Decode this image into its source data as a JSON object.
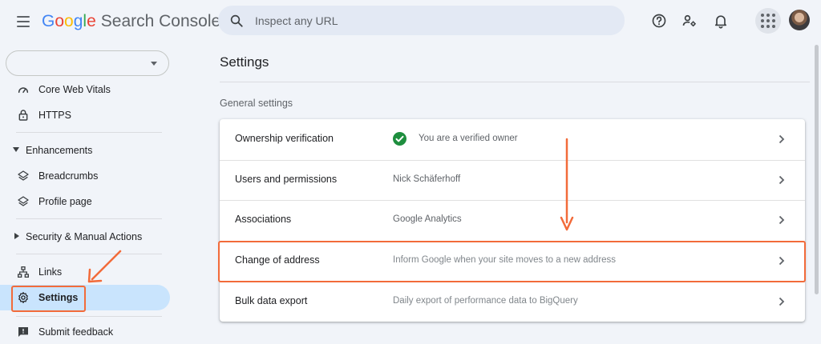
{
  "app": {
    "brand_letters": [
      "G",
      "o",
      "o",
      "g",
      "l",
      "e"
    ],
    "product": "Search Console"
  },
  "search": {
    "placeholder": "Inspect any URL"
  },
  "toolbar": {
    "icons": [
      "help-icon",
      "manage-accounts-icon",
      "notifications-icon",
      "apps-icon",
      "avatar"
    ]
  },
  "sidebar": {
    "property_value": "",
    "items": [
      {
        "label": "Core Web Vitals",
        "icon": "speed-gauge-icon"
      },
      {
        "label": "HTTPS",
        "icon": "lock-icon"
      },
      {
        "label": "Enhancements",
        "icon": "collapse-triangle-icon"
      },
      {
        "label": "Breadcrumbs",
        "icon": "layers-icon"
      },
      {
        "label": "Profile page",
        "icon": "layers-icon"
      },
      {
        "label": "Security & Manual Actions",
        "icon": "expand-triangle-icon"
      },
      {
        "label": "Links",
        "icon": "links-icon"
      },
      {
        "label": "Settings",
        "icon": "gear-icon",
        "active": true
      },
      {
        "label": "Submit feedback",
        "icon": "feedback-icon"
      }
    ]
  },
  "main": {
    "title": "Settings",
    "section_label": "General settings",
    "rows": [
      {
        "name": "Ownership verification",
        "value": "You are a verified owner",
        "status": "verified"
      },
      {
        "name": "Users and permissions",
        "value": "Nick Schäferhoff"
      },
      {
        "name": "Associations",
        "value": "Google Analytics"
      },
      {
        "name": "Change of address",
        "value": "Inform Google when your site moves to a new address"
      },
      {
        "name": "Bulk data export",
        "value": "Daily export of performance data to BigQuery"
      }
    ]
  },
  "colors": {
    "accent_highlight": "#f26b3a",
    "active_nav": "#c9e4fd",
    "verified_green": "#1e8e3e",
    "background": "#f1f4f9"
  }
}
